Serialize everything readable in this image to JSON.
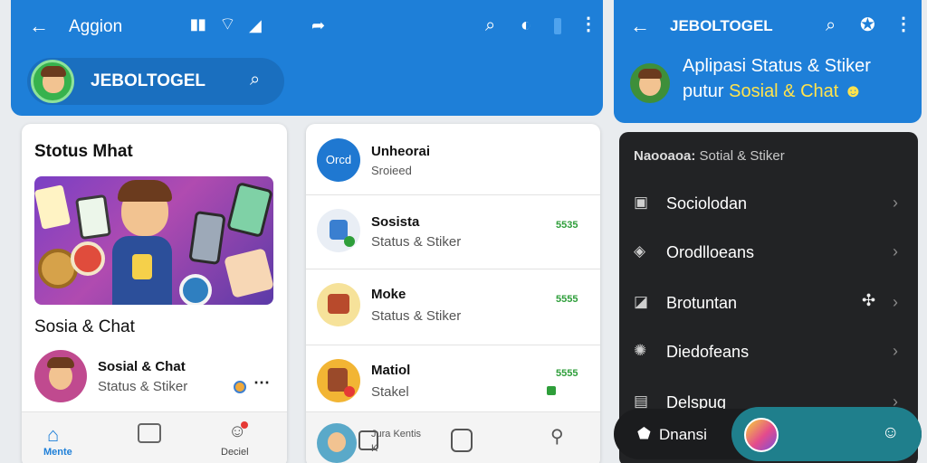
{
  "header_left": {
    "back_label": "Aggion",
    "pill_title": "JEBOLTOGEL"
  },
  "header_right": {
    "title": "JEBOLTOGEL",
    "promo_line1": "Aplipasi Status & Stiker",
    "promo_line2_prefix": "putur",
    "promo_line2_highlight": "Sosial & Chat"
  },
  "card1": {
    "title": "Stotus Mhat",
    "subtitle": "Sosia & Chat",
    "item": {
      "title": "Sosial & Chat",
      "sub": "Status & Stiker"
    },
    "nav": {
      "home_label": "Mente",
      "profile_label": "Deciel"
    }
  },
  "chat_list": [
    {
      "title": "Unheorai",
      "sub": "Sroieed",
      "avatar_text": "Orcd",
      "stat": ""
    },
    {
      "title": "Sosista",
      "sub": "Status & Stiker",
      "avatar_text": "",
      "stat": "5535"
    },
    {
      "title": "Moke",
      "sub": "Status & Stiker",
      "avatar_text": "",
      "stat": "5555"
    },
    {
      "title": "Matiol",
      "sub": "Stakel",
      "avatar_text": "",
      "stat": "5555"
    }
  ],
  "card2_bottom": {
    "line1": "Jura Kentis",
    "line2": "K"
  },
  "dark_panel": {
    "heading_label": "Naooaoa:",
    "heading_value": "Sotial & Stiker",
    "items": [
      "Sociolodan",
      "Orodlloeans",
      "Brotuntan",
      "Diedofeans",
      "Delspug"
    ],
    "bottom_label": "Dnansi"
  },
  "colors": {
    "header_blue": "#1e7fd8",
    "highlight_yellow": "#ffe34d",
    "dark_panel": "#222325",
    "teal_pill": "#1f7f8c",
    "green_stat": "#2e9e3a"
  }
}
